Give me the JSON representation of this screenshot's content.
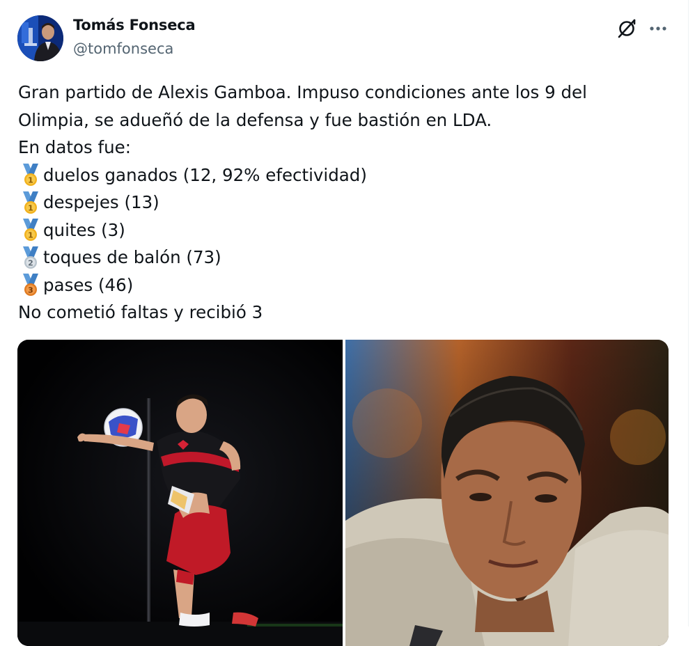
{
  "author": {
    "name": "Tomás Fonseca",
    "handle": "@tomfonseca"
  },
  "icons": {
    "grok": "grok-icon",
    "more": "more-horizontal-icon",
    "medal_gold": "first-place-medal-icon",
    "medal_silver": "second-place-medal-icon",
    "medal_bronze": "third-place-medal-icon"
  },
  "colors": {
    "text": "#0f1419",
    "secondary": "#536471",
    "medal_gold": "#f2b21e",
    "medal_silver": "#c9d2da",
    "medal_bronze": "#f0892a",
    "ribbon": "#5c9bd9"
  },
  "tweet": {
    "line1": "Gran partido de Alexis Gamboa. Impuso condiciones ante los 9 del",
    "line2": "Olimpia, se adueñó de la defensa y fue bastión en LDA.",
    "line3": "En datos fue:",
    "stats": [
      {
        "medal": "1",
        "text": "duelos ganados (12, 92% efectividad)"
      },
      {
        "medal": "1",
        "text": "despejes (13)"
      },
      {
        "medal": "1",
        "text": "quites (3)"
      },
      {
        "medal": "2",
        "text": "toques de balón (73)"
      },
      {
        "medal": "3",
        "text": "pases (46)"
      }
    ],
    "closing": "No cometió faltas y recibió 3"
  },
  "media": [
    {
      "name": "photo-player-kicking-ball"
    },
    {
      "name": "photo-player-portrait"
    }
  ]
}
